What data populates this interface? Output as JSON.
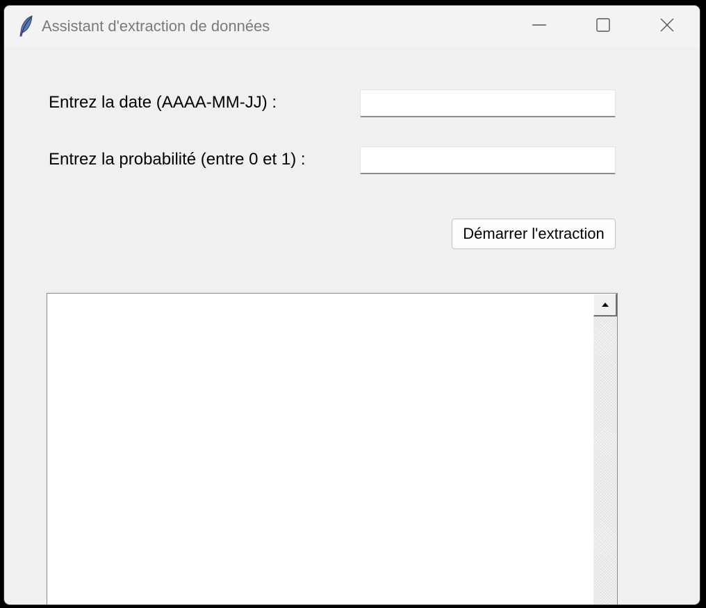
{
  "window": {
    "title": "Assistant d'extraction de données",
    "icon": "feather-icon",
    "controls": [
      "minimize-icon",
      "maximize-icon",
      "close-icon"
    ]
  },
  "form": {
    "date_label": "Entrez la date (AAAA-MM-JJ) :",
    "date_value": "",
    "prob_label": "Entrez la probabilité (entre 0 et 1) :",
    "prob_value": "",
    "start_button": "Démarrer l'extraction"
  },
  "output": {
    "text": "",
    "scroll_up_icon": "scroll-up-arrow-icon"
  },
  "colors": {
    "window_bg": "#f0f0f0",
    "titlebar_bg": "#f3f3f3",
    "title_text": "#7a7a7a",
    "feather_blue": "#5b7bb0"
  }
}
